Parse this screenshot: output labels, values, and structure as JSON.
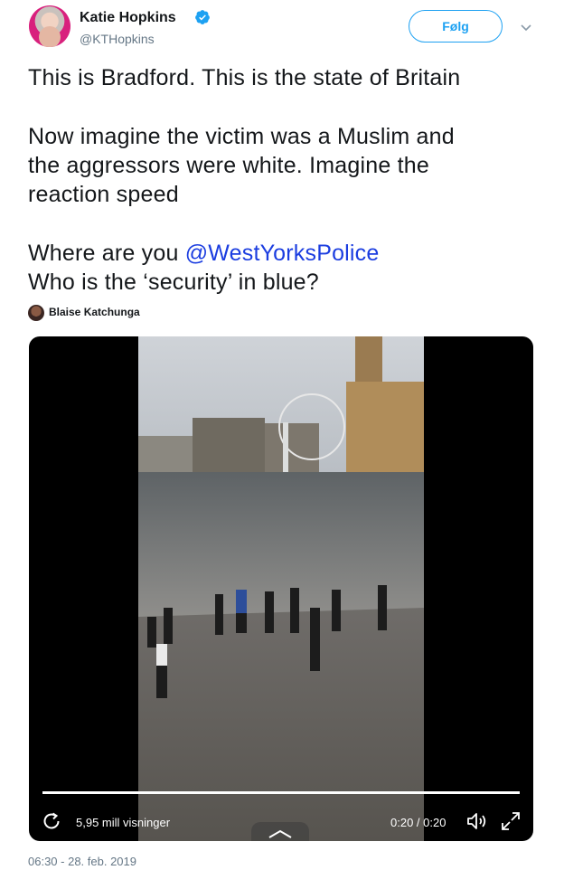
{
  "author": {
    "name": "Katie Hopkins",
    "handle": "@KTHopkins",
    "verified": true,
    "follow_label": "Følg"
  },
  "tweet": {
    "lines": [
      "This is Bradford. This is the state of Britain",
      "Now imagine the victim was a Muslim and",
      "the aggressors were white.  Imagine the",
      "reaction speed",
      "Where are you ",
      "Who is the ‘security’ in blue?"
    ],
    "mention": "@WestYorksPolice"
  },
  "media_credit": {
    "name": "Blaise Katchunga"
  },
  "video": {
    "views": "5,95 mill visninger",
    "time": "0:20 / 0:20",
    "progress": 1.0
  },
  "timestamp": "06:30 - 28. feb. 2019",
  "colors": {
    "accent": "#1da1f2",
    "mention": "#1b3de0",
    "meta_gray": "#657786"
  },
  "icons": [
    "verified-badge-icon",
    "chevron-down-icon",
    "replay-icon",
    "volume-icon",
    "expand-icon",
    "collapse-up-icon"
  ]
}
